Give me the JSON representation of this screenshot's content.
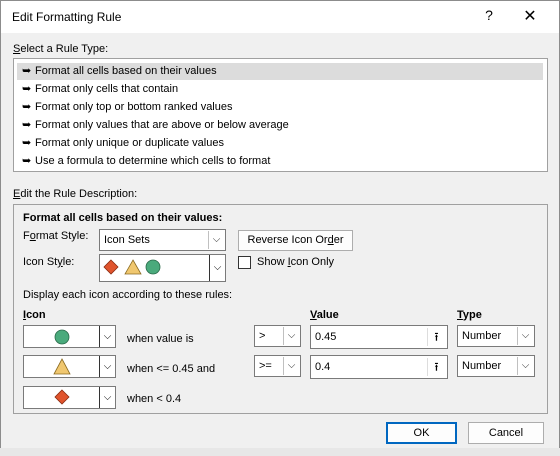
{
  "window": {
    "title": "Edit Formatting Rule",
    "help_glyph": "?",
    "close_glyph": "✕"
  },
  "rule_type": {
    "label_pre": "",
    "label_ul": "S",
    "label_post": "elect a Rule Type:",
    "items": [
      {
        "label": "Format all cells based on their values",
        "selected": true
      },
      {
        "label": "Format only cells that contain",
        "selected": false
      },
      {
        "label": "Format only top or bottom ranked values",
        "selected": false
      },
      {
        "label": "Format only values that are above or below average",
        "selected": false
      },
      {
        "label": "Format only unique or duplicate values",
        "selected": false
      },
      {
        "label": "Use a formula to determine which cells to format",
        "selected": false
      }
    ],
    "bullet": "➥"
  },
  "description": {
    "label_ul": "E",
    "label_post": "dit the Rule Description:",
    "heading": "Format all cells based on their values:",
    "format_style_label_pre": "F",
    "format_style_label_ul": "o",
    "format_style_label_post": "rmat Style:",
    "format_style_value": "Icon Sets",
    "reverse_pre": "Reverse Icon Or",
    "reverse_ul": "d",
    "reverse_post": "er",
    "icon_style_label_pre": "Icon St",
    "icon_style_label_ul": "y",
    "icon_style_label_post": "le:",
    "show_icon_pre": "Show ",
    "show_icon_ul": "I",
    "show_icon_post": "con Only",
    "show_icon_checked": false,
    "rules_caption": "Display each icon according to these rules:",
    "col_icon_ul": "I",
    "col_icon_post": "con",
    "col_value_ul": "V",
    "col_value_post": "alue",
    "col_type_ul": "T",
    "col_type_post": "ype",
    "rows": [
      {
        "icon": "green-circle",
        "text": "when value is",
        "operator": ">",
        "value": "0.45",
        "type": "Number"
      },
      {
        "icon": "yellow-triangle",
        "text": "when <= 0.45 and",
        "operator": ">=",
        "value": "0.4",
        "type": "Number"
      },
      {
        "icon": "red-diamond",
        "text": "when < 0.4"
      }
    ],
    "colors": {
      "green": "#4aaa7c",
      "yellow": "#f0c76f",
      "red": "#e0542d"
    }
  },
  "buttons": {
    "ok": "OK",
    "cancel": "Cancel"
  },
  "dropdown_glyph": "⌵",
  "ref_glyph": "⭱"
}
